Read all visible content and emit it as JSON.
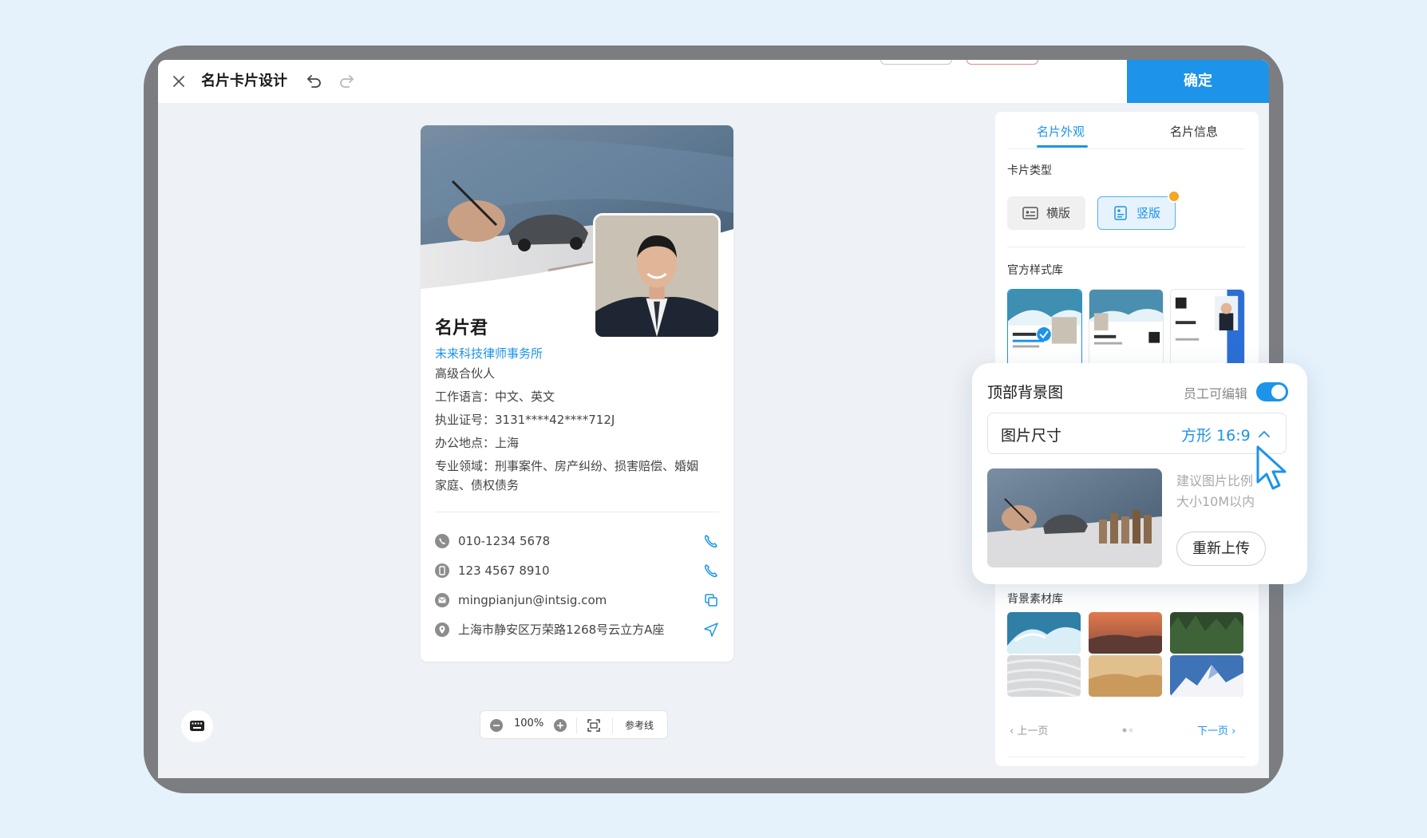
{
  "topbar": {
    "title": "名片卡片设计",
    "confirm_label": "确定"
  },
  "card": {
    "name": "名片君",
    "company": "未来科技律师事务所",
    "position": "高级合伙人",
    "language": "工作语言：中文、英文",
    "license": "执业证号：3131****42****712J",
    "office": "办公地点：上海",
    "field_line1": "专业领域：刑事案件、房产纠纷、损害赔偿、婚姻",
    "field_line2": "家庭、债权债务",
    "contacts": [
      {
        "icon": "phone-circle-icon",
        "text": "010-1234 5678",
        "action": "call-icon"
      },
      {
        "icon": "mobile-circle-icon",
        "text": "123 4567 8910",
        "action": "call-icon"
      },
      {
        "icon": "mail-circle-icon",
        "text": "mingpianjun@intsig.com",
        "action": "copy-icon"
      },
      {
        "icon": "location-circle-icon",
        "text": "上海市静安区万荣路1268号云立方A座",
        "action": "navigate-icon"
      }
    ]
  },
  "zoom": {
    "value": "100%",
    "guide_label": "参考线"
  },
  "panel": {
    "tabs": [
      "名片外观",
      "名片信息"
    ],
    "card_type_label": "卡片类型",
    "type_horizontal": "横版",
    "type_vertical": "竖版",
    "official_styles_label": "官方样式库",
    "materials_label": "背景素材库",
    "prev_page": "上一页",
    "next_page": "下一页"
  },
  "popup": {
    "title": "顶部背景图",
    "editable_label": "员工可编辑",
    "editable_on": true,
    "size_label": "图片尺寸",
    "size_value": "方形 16:9",
    "hint_line1": "建议图片比例",
    "hint_line2": "大小10M以内",
    "reupload_label": "重新上传"
  },
  "colors": {
    "accent": "#1d93ea",
    "background": "#e5f2fc",
    "device_frame": "#7b7d80"
  }
}
